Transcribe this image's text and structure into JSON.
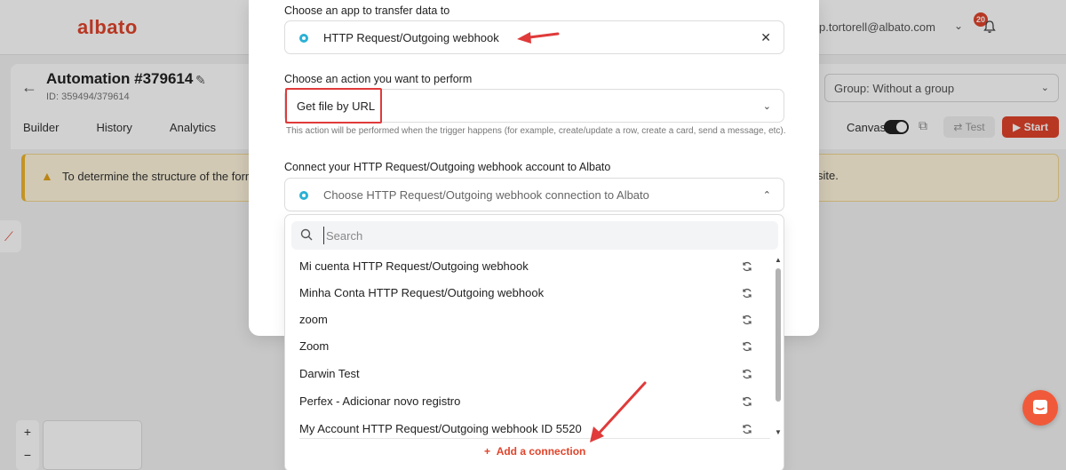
{
  "app": {
    "logo": "albato",
    "user_email": "p.tortorell@albato.com",
    "notification_count": "20"
  },
  "automation": {
    "title": "Automation #379614",
    "id_text": "ID: 359494/379614",
    "tabs": [
      "Builder",
      "History",
      "Analytics"
    ],
    "group_select": "Group: Without a group",
    "canvas_label": "Canvas",
    "test_label": "Test",
    "start_label": "Start"
  },
  "banner": {
    "text": "To determine the structure of the form",
    "tail": "site."
  },
  "modal": {
    "app_label": "Choose an app to transfer data to",
    "app_value": "HTTP Request/Outgoing webhook",
    "action_label": "Choose an action you want to perform",
    "action_value": "Get file by URL",
    "action_helper": "This action will be performed when the trigger happens (for example, create/update a row, create a card, send a message, etc).",
    "connect_label": "Connect your HTTP Request/Outgoing webhook account to Albato",
    "connect_placeholder": "Choose HTTP Request/Outgoing webhook connection to Albato"
  },
  "dropdown": {
    "search_placeholder": "Search",
    "connections": [
      "Mi cuenta HTTP Request/Outgoing webhook",
      "Minha Conta HTTP Request/Outgoing webhook",
      "zoom",
      "Zoom",
      "Darwin Test",
      "Perfex - Adicionar novo registro",
      "My Account HTTP Request/Outgoing webhook ID 5520"
    ],
    "add_connection": "Add a connection"
  },
  "colors": {
    "brand": "#e0442b",
    "highlight": "#e03a3a",
    "warning": "#f0b52a",
    "app_icon": "#2bb1d5"
  }
}
